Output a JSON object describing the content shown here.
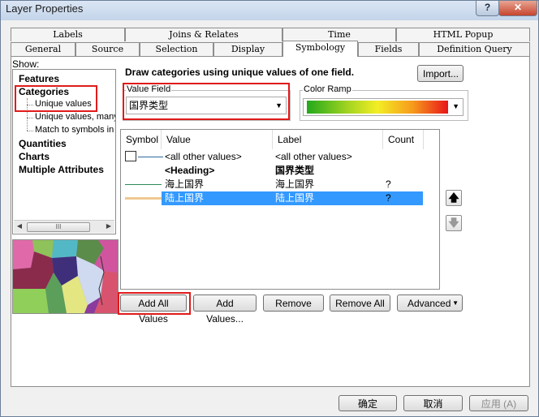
{
  "window": {
    "title": "Layer Properties",
    "help_glyph": "?",
    "close_glyph": "✕"
  },
  "tabs": {
    "row_back": [
      "Labels",
      "Joins & Relates",
      "Time",
      "HTML Popup"
    ],
    "row_front": [
      "General",
      "Source",
      "Selection",
      "Display",
      "Symbology",
      "Fields",
      "Definition Query"
    ],
    "active": "Symbology"
  },
  "show": {
    "label": "Show:",
    "items": [
      "Features",
      "Categories",
      "Quantities",
      "Charts",
      "Multiple Attributes"
    ],
    "sub_items": [
      "Unique values",
      "Unique values, many",
      "Match to symbols in a"
    ],
    "scroll_thumb": "III"
  },
  "main": {
    "heading": "Draw categories using unique values of one field.",
    "import_label": "Import...",
    "value_field_label": "Value Field",
    "value_field_value": "国界类型",
    "color_ramp_label": "Color Ramp"
  },
  "table": {
    "columns": [
      "Symbol",
      "Value",
      "Label",
      "Count"
    ],
    "rows": [
      {
        "value": "<all other values>",
        "label": "<all other values>",
        "count": ""
      },
      {
        "value": "<Heading>",
        "label": "国界类型",
        "count": ""
      },
      {
        "value": "海上国界",
        "label": "海上国界",
        "count": "?"
      },
      {
        "value": "陆上国界",
        "label": "陆上国界",
        "count": "?"
      }
    ]
  },
  "buttons": {
    "add_all": "Add All Values",
    "add": "Add Values...",
    "remove": "Remove",
    "remove_all": "Remove All",
    "advanced": "Advanced",
    "ok": "确定",
    "cancel": "取消",
    "apply": "应用 (A)"
  },
  "colors": {
    "highlight": "#e01b1b",
    "selection": "#3399ff",
    "sea_line": "#2e8b57",
    "land_line": "#f0c890"
  }
}
